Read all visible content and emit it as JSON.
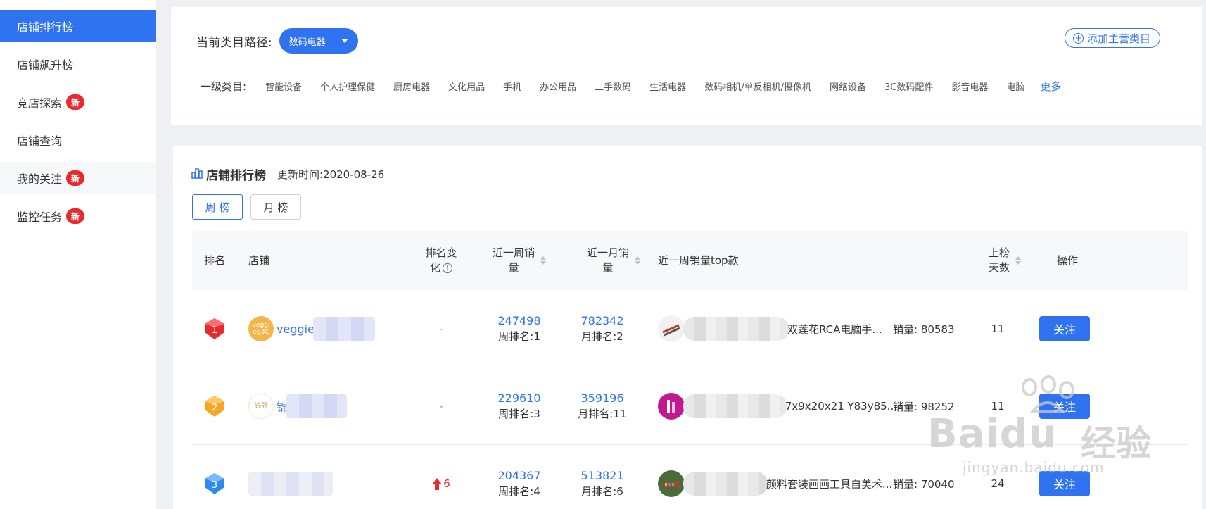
{
  "sidebar": {
    "items": [
      {
        "label": "店铺排行榜",
        "badge": ""
      },
      {
        "label": "店铺飙升榜",
        "badge": ""
      },
      {
        "label": "竞店探索",
        "badge": "新"
      },
      {
        "label": "店铺查询",
        "badge": ""
      },
      {
        "label": "我的关注",
        "badge": "新"
      },
      {
        "label": "监控任务",
        "badge": "新"
      }
    ]
  },
  "category": {
    "path_label": "当前类目路径:",
    "path_value": "数码电器",
    "add_button": "添加主营类目",
    "level1_label": "一级类目:",
    "items": [
      "智能设备",
      "个人护理保健",
      "厨房电器",
      "文化用品",
      "手机",
      "办公用品",
      "二手数码",
      "生活电器",
      "数码相机/单反相机/摄像机",
      "网络设备",
      "3C数码配件",
      "影音电器",
      "电脑"
    ],
    "more": "更多"
  },
  "ranking": {
    "title": "店铺排行榜",
    "update_time": "更新时间:2020-08-26",
    "tabs": [
      "周 榜",
      "月 榜"
    ],
    "columns": {
      "rank": "排名",
      "store": "店铺",
      "change_line1": "排名变",
      "change_line2": "化",
      "week_line1": "近一周销",
      "week_line2": "量",
      "month_line1": "近一月销",
      "month_line2": "量",
      "top_item": "近一周销量top款",
      "days_line1": "上榜",
      "days_line2": "天数",
      "action": "操作"
    },
    "rows": [
      {
        "rank": "1",
        "store_name": "veggie",
        "logo_text": "veggi eg3C",
        "change": "-",
        "week_sales": "247498",
        "week_rank": "周排名:1",
        "month_sales": "782342",
        "month_rank": "月排名:2",
        "top_item": "双莲花RCA电脑手...",
        "top_sales": "销量: 80583",
        "days": "11",
        "action": "关注"
      },
      {
        "rank": "2",
        "store_name": "锦",
        "logo_text": "锦冠",
        "change": "-",
        "week_sales": "229610",
        "week_rank": "周排名:3",
        "month_sales": "359196",
        "month_rank": "月排名:11",
        "top_item": "7x9x20x21 Y83y85...",
        "top_sales": "销量: 98252",
        "days": "11",
        "action": "关注"
      },
      {
        "rank": "3",
        "store_name": "",
        "logo_text": "",
        "change": "6",
        "week_sales": "204367",
        "week_rank": "周排名:4",
        "month_sales": "513821",
        "month_rank": "月排名:6",
        "top_item": "颜料套装画画工具自美术...",
        "top_sales": "销量: 70040",
        "days": "24",
        "action": "关注"
      }
    ]
  },
  "watermark": {
    "brand": "Baidu",
    "cn": "经验",
    "url": "jingyan.baidu.com"
  },
  "colors": {
    "accent": "#2f73f0",
    "badge": "#e8292f",
    "rank1": "#e8292f",
    "rank2": "#f5a623",
    "rank3": "#2f8af0"
  }
}
